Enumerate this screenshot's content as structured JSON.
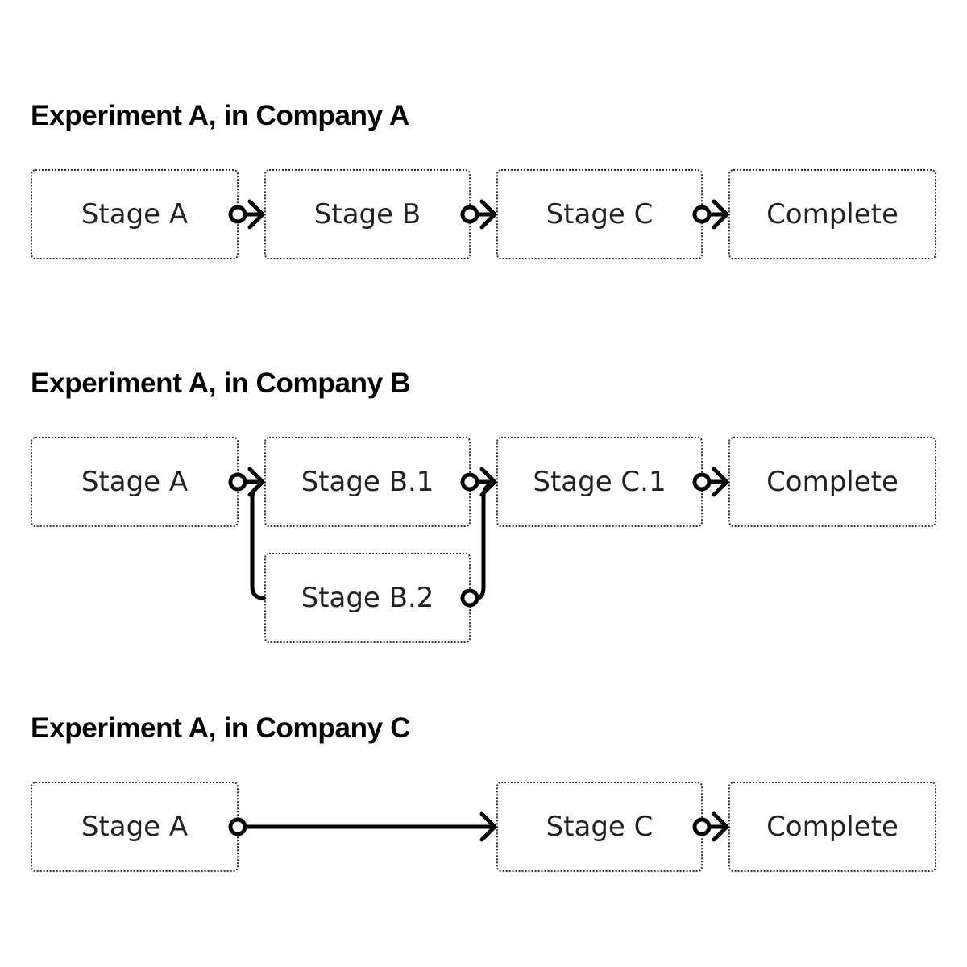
{
  "diagrams": [
    {
      "title": "Experiment A, in Company A",
      "stages": [
        "Stage A",
        "Stage B",
        "Stage C",
        "Complete"
      ]
    },
    {
      "title": "Experiment A, in Company B",
      "stages": [
        "Stage A",
        "Stage B.1",
        "Stage B.2",
        "Stage C.1",
        "Complete"
      ]
    },
    {
      "title": "Experiment A, in Company C",
      "stages": [
        "Stage A",
        "Stage C",
        "Complete"
      ]
    }
  ],
  "colors": {
    "connector": "#000000",
    "border": "#333333",
    "text": "#222222"
  }
}
